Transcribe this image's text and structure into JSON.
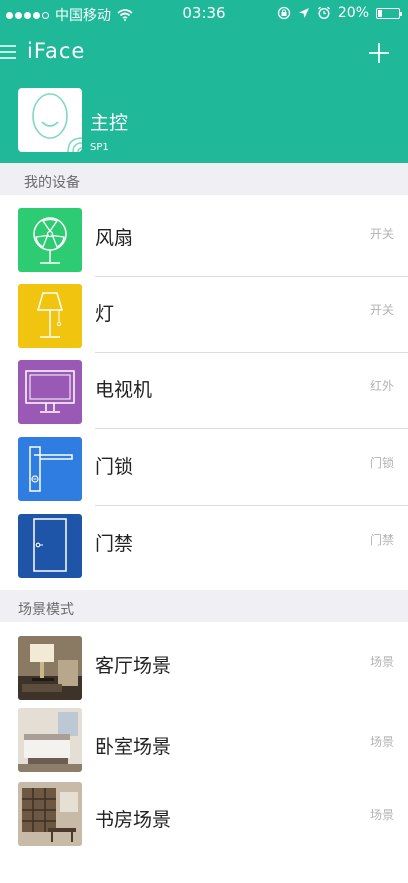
{
  "status_bar": {
    "carrier": "中国移动",
    "time": "03:36",
    "battery": "20%"
  },
  "nav": {
    "title": "iFace"
  },
  "controller": {
    "name": "主控",
    "model": "SP1"
  },
  "sections": {
    "devices": "我的设备",
    "scenes": "场景模式"
  },
  "devices": [
    {
      "label": "风扇",
      "tag": "开关",
      "icon": "fan-icon",
      "color": "#2dcc72"
    },
    {
      "label": "灯",
      "tag": "开关",
      "icon": "lamp-icon",
      "color": "#f1c40f"
    },
    {
      "label": "电视机",
      "tag": "红外",
      "icon": "tv-icon",
      "color": "#9b59b6"
    },
    {
      "label": "门锁",
      "tag": "门锁",
      "icon": "door-lock-icon",
      "color": "#2f7de1"
    },
    {
      "label": "门禁",
      "tag": "门禁",
      "icon": "door-icon",
      "color": "#1f55a8"
    }
  ],
  "scenes": [
    {
      "label": "客厅场景",
      "tag": "场景",
      "icon": "living-room-photo"
    },
    {
      "label": "卧室场景",
      "tag": "场景",
      "icon": "bedroom-photo"
    },
    {
      "label": "书房场景",
      "tag": "场景",
      "icon": "study-room-photo"
    }
  ]
}
